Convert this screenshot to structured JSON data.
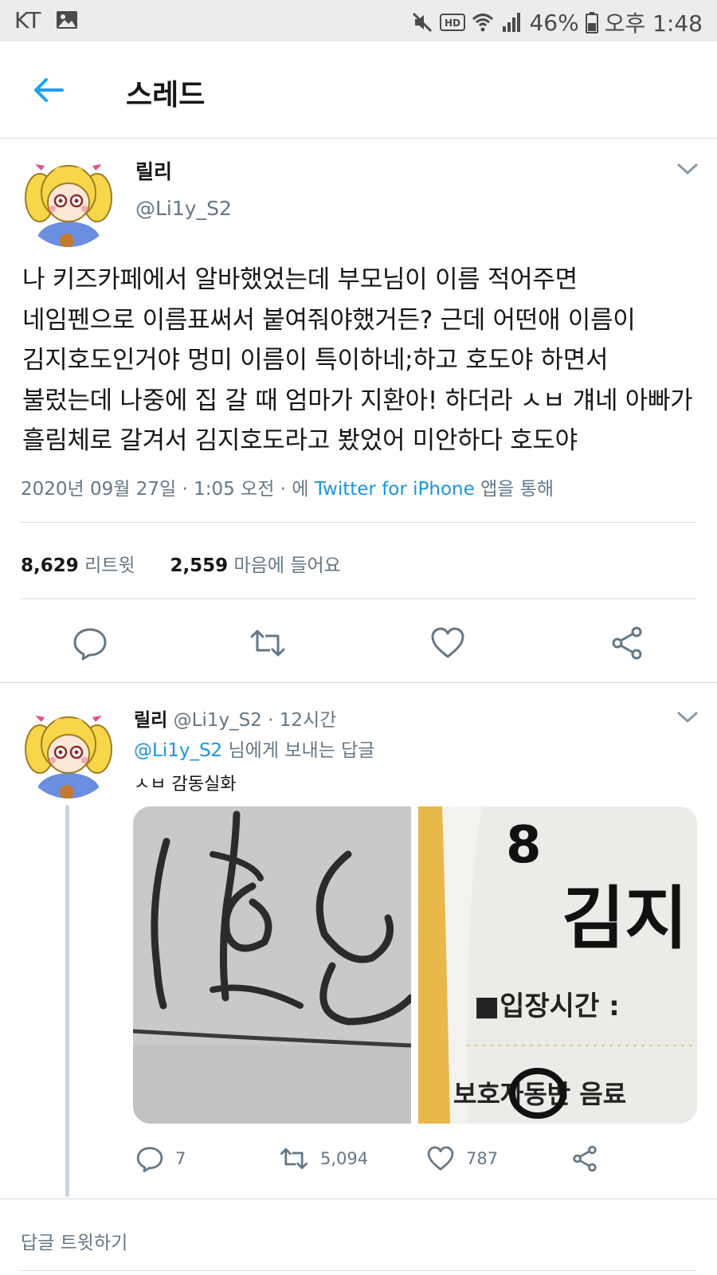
{
  "status_bar": {
    "carrier": "KT",
    "battery": "46%",
    "time": "오후 1:48",
    "icons": [
      "gallery-icon",
      "mute-icon",
      "hd-icon",
      "wifi-icon",
      "signal-icon",
      "battery-icon"
    ]
  },
  "header": {
    "title": "스레드",
    "back_icon": "arrow-left-icon"
  },
  "main_tweet": {
    "name": "릴리",
    "handle": "@Li1y_S2",
    "text_lines": [
      "나 키즈카페에서 알바했었는데 부모님이 이름 적어주면",
      "네임펜으로 이름표써서 붙여줘야했거든? 근데 어떤애 이름이",
      "김지호도인거야 멍미 이름이 특이하네;하고 호도야 하면서",
      "불렀는데 나중에 집 갈 때 엄마가 지환아! 하더라 ㅅㅂ 걔네 아빠가",
      "흘림체로 갈겨서 김지호도라고 봤었어 미안하다 호도야"
    ],
    "meta_prefix": "2020년 09월 27일 · 1:05 오전 · 에 ",
    "meta_link": "Twitter for iPhone",
    "meta_suffix": " 앱을 통해",
    "retweets_count": "8,629",
    "retweets_label": "리트윗",
    "likes_count": "2,559",
    "likes_label": "마음에 들어요"
  },
  "reply_tweet": {
    "name": "릴리",
    "handle": "@Li1y_S2",
    "time": "12시간",
    "reply_to_handle": "@Li1y_S2",
    "reply_to_suffix": " 님에게 보내는 답글",
    "text": "ㅅㅂ 감동실화",
    "photo2_text_number": "8",
    "photo2_text_name": "김지",
    "photo2_text_entry": "■입장시간 :",
    "photo2_text_bottom": "보호자동반 음료 ",
    "reply_count": "7",
    "retweet_count": "5,094",
    "like_count": "787"
  },
  "compose": {
    "label": "답글 트윗하기"
  },
  "colors": {
    "link": "#1b95e0",
    "secondary_text": "#657786",
    "divider": "#dadfe3",
    "status_bar_bg": "#ececec"
  }
}
